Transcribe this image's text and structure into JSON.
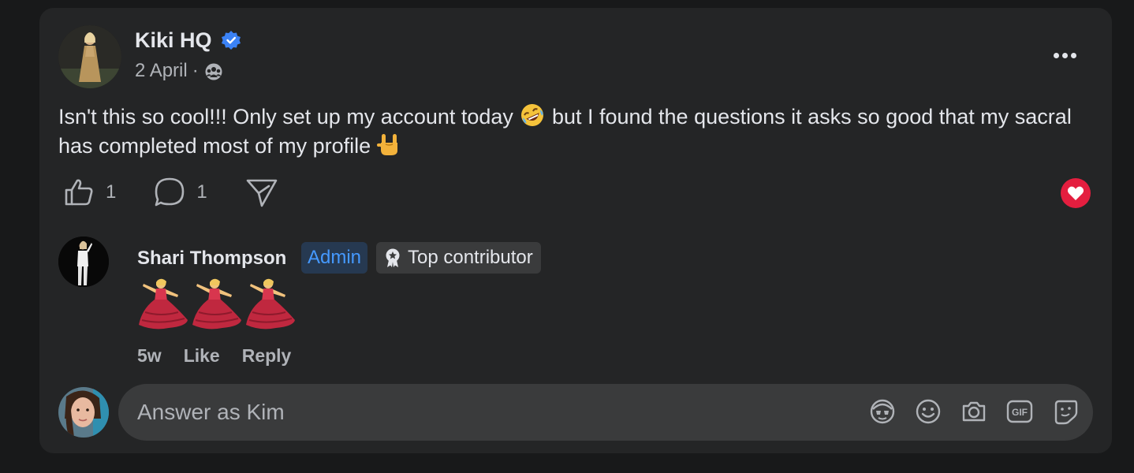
{
  "post": {
    "author": "Kiki HQ",
    "date": "2 April",
    "separator": "·",
    "text_part1": "Isn't this so cool!!! Only set up my account today ",
    "text_part2": " but I found the questions it asks so good that my sacral has completed most of my profile ",
    "emoji_1": "rolling-on-floor-laughing",
    "emoji_2": "sign-of-the-horns",
    "like_count": "1",
    "comment_count": "1",
    "reaction": "love",
    "colors": {
      "love": "#e41e3f",
      "verified": "#3b82f6"
    }
  },
  "comment": {
    "author": "Shari Thompson",
    "badge_admin": "Admin",
    "badge_top": "Top contributor",
    "emojis": [
      "woman-dancing",
      "woman-dancing",
      "woman-dancing"
    ],
    "time": "5w",
    "like_label": "Like",
    "reply_label": "Reply"
  },
  "reply": {
    "placeholder": "Answer as Kim",
    "tools": [
      "avatar-sticker-icon",
      "emoji-icon",
      "camera-icon",
      "gif-icon",
      "sticker-icon"
    ]
  }
}
